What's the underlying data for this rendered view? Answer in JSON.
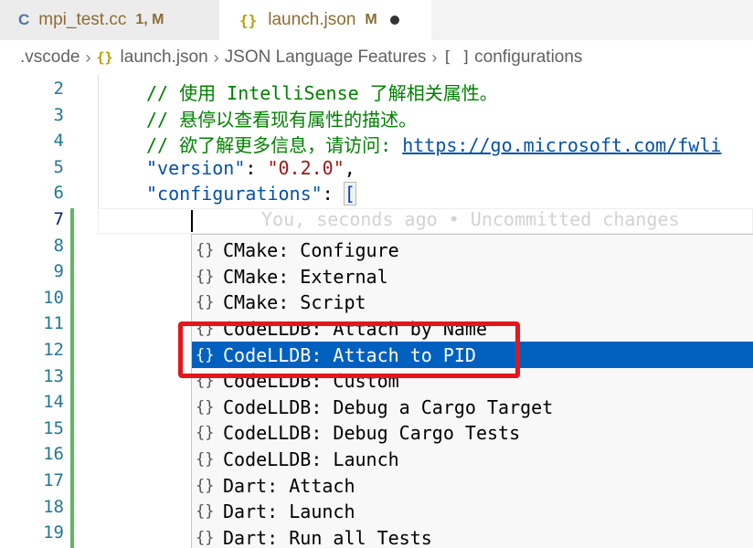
{
  "tabs": [
    {
      "icon": "C",
      "name": "mpi_test.cc",
      "badge": "1, M"
    },
    {
      "icon": "{}",
      "name": "launch.json",
      "badge": "M"
    }
  ],
  "breadcrumb": {
    "folder": ".vscode",
    "file_icon": "{}",
    "file": "launch.json",
    "section": "JSON Language Features",
    "array_icon": "[ ]",
    "symbol": "configurations"
  },
  "editor": {
    "line_numbers": [
      "2",
      "3",
      "4",
      "5",
      "6",
      "7",
      "8",
      "9",
      "10",
      "11",
      "12",
      "13",
      "14",
      "15",
      "16",
      "17",
      "18",
      "19"
    ],
    "comment1_prefix": "// ",
    "comment1_text": "使用 IntelliSense 了解相关属性。",
    "comment2_prefix": "// ",
    "comment2_text": "悬停以查看现有属性的描述。",
    "comment3_prefix": "// ",
    "comment3_text": "欲了解更多信息，请访问: ",
    "comment3_link": "https://go.microsoft.com/fwli",
    "version_key": "\"version\"",
    "version_colon": ": ",
    "version_value": "\"0.2.0\"",
    "version_comma": ",",
    "configurations_key": "\"configurations\"",
    "configurations_colon": ": ",
    "configurations_bracket": "[",
    "ghost_text": "You, seconds ago • Uncommitted changes"
  },
  "suggestions": [
    {
      "icon": "{}",
      "label": "CMake: Configure"
    },
    {
      "icon": "{}",
      "label": "CMake: External"
    },
    {
      "icon": "{}",
      "label": "CMake: Script"
    },
    {
      "icon": "{}",
      "label": "CodeLLDB: Attach by Name"
    },
    {
      "icon": "{}",
      "label": "CodeLLDB: Attach to PID",
      "selected": true
    },
    {
      "icon": "{}",
      "label": "CodeLLDB: Custom"
    },
    {
      "icon": "{}",
      "label": "CodeLLDB: Debug a Cargo Target"
    },
    {
      "icon": "{}",
      "label": "CodeLLDB: Debug Cargo Tests"
    },
    {
      "icon": "{}",
      "label": "CodeLLDB: Launch"
    },
    {
      "icon": "{}",
      "label": "Dart: Attach"
    },
    {
      "icon": "{}",
      "label": "Dart: Launch"
    },
    {
      "icon": "{}",
      "label": "Dart: Run all Tests"
    }
  ],
  "colors": {
    "selection": "#0060c0",
    "highlight_box": "#e3161c",
    "git_added": "#5fb863"
  }
}
